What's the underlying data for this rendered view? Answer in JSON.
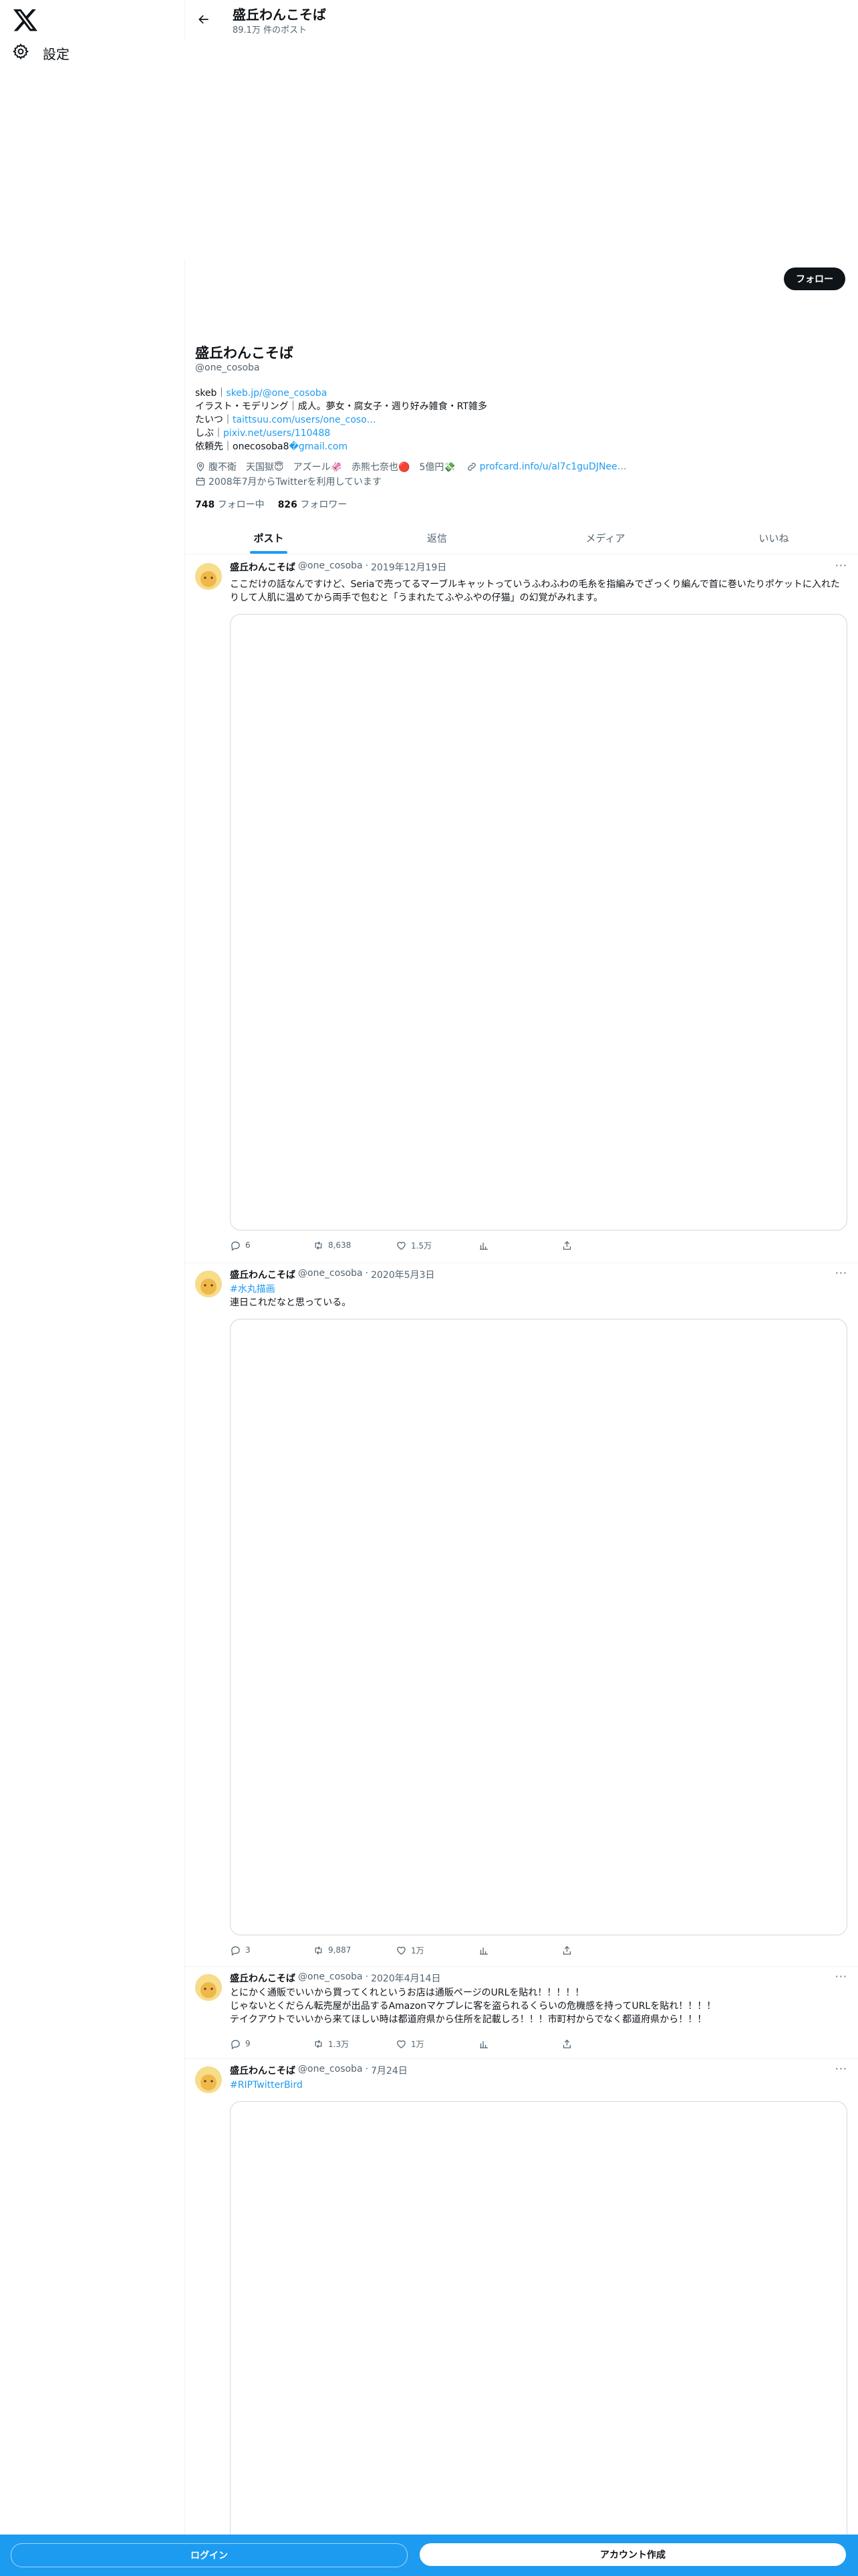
{
  "sidebar": {
    "settings_label": "設定"
  },
  "header": {
    "name": "盛丘わんこそば",
    "post_count": "89.1万 件のポスト"
  },
  "profile": {
    "follow_label": "フォロー",
    "name": "盛丘わんこそば",
    "handle": "@one_cosoba",
    "bio": {
      "l1_prefix": "skeb｜",
      "l1_link": "skeb.jp/@one_cosoba",
      "l2": "イラスト・モデリング｜成人。夢女・腐女子・週り好み雑食・RT雑多",
      "l3_prefix": "たいつ｜",
      "l3_link": "taittsuu.com/users/one_coso…",
      "l4_prefix": "しぶ｜",
      "l4_link": "pixiv.net/users/110488",
      "l5_prefix": "依頼先｜onecosoba8",
      "l5_link": "�gmail.com"
    },
    "location": "腹不衛　天国獄😇　アズール🦑　赤熊七奈也🔴　5億円💸",
    "website": "profcard.info/u/al7c1guDJNee…",
    "joined": "2008年7月からTwitterを利用しています",
    "following_count": "748",
    "following_label": "フォロー中",
    "followers_count": "826",
    "followers_label": "フォロワー"
  },
  "tabs": [
    "ポスト",
    "返信",
    "メディア",
    "いいね"
  ],
  "tweets": [
    {
      "name": "盛丘わんこそば",
      "handle": "@one_cosoba",
      "dot": "·",
      "date": "2019年12月19日",
      "text": "ここだけの話なんですけど、Seriaで売ってるマーブルキャットっていうふわふわの毛糸を指編みでざっくり編んで首に巻いたりポケットに入れたりして人肌に温めてから両手で包むと「うまれたてふやふやの仔猫」の幻覚がみれます。",
      "reply": "6",
      "retweet": "8,638",
      "like": "1.5万"
    },
    {
      "name": "盛丘わんこそば",
      "handle": "@one_cosoba",
      "dot": "·",
      "date": "2020年5月3日",
      "hashtag": "#水丸描画",
      "text": "連日これだなと思っている。",
      "reply": "3",
      "retweet": "9,887",
      "like": "1万"
    },
    {
      "name": "盛丘わんこそば",
      "handle": "@one_cosoba",
      "dot": "·",
      "date": "2020年4月14日",
      "l1": "とにかく通販でいいから買ってくれというお店は通販ページのURLを貼れ！！！！！",
      "l2": "じゃないとくだらん転売屋が出品するAmazonマケプレに客を盗られるくらいの危機感を持ってURLを貼れ！！！！",
      "l3": "テイクアウトでいいから来てほしい時は都道府県から住所を記載しろ！！！市町村からでなく都道府県から！！！",
      "reply": "9",
      "retweet": "1.3万",
      "like": "1万"
    },
    {
      "name": "盛丘わんこそば",
      "handle": "@one_cosoba",
      "dot": "·",
      "date": "7月24日",
      "hashtag": "#RIPTwitterBird"
    }
  ],
  "bottom": {
    "login": "ログイン",
    "signup": "アカウント作成"
  },
  "colors": {
    "accent": "#1d9bf0",
    "text": "#0f1419",
    "muted": "#536471"
  }
}
